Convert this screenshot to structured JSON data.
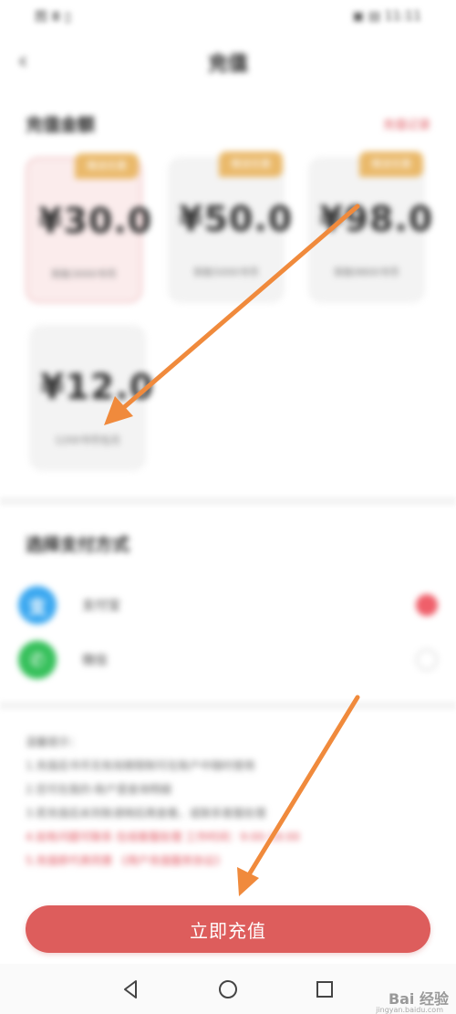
{
  "status_bar": {
    "left": "图 Ⅲ ▯",
    "right": "▣ ▤ 11:11"
  },
  "header": {
    "title": "充值",
    "back_glyph": "‹"
  },
  "amount_section": {
    "title": "充值金额",
    "link": "充值记录",
    "cards": [
      {
        "badge": "赠送优惠",
        "amount": "¥30.0",
        "desc": "到账3000书币",
        "selected": true
      },
      {
        "badge": "赠送优惠",
        "amount": "¥50.0",
        "desc": "到账5000书币",
        "selected": false
      },
      {
        "badge": "赠送优惠",
        "amount": "¥98.0",
        "desc": "到账9800书币",
        "selected": false
      },
      {
        "badge": "",
        "amount": "¥12.0",
        "desc": "1200书币包月",
        "selected": false
      }
    ]
  },
  "payment": {
    "title": "选择支付方式",
    "methods": [
      {
        "label": "支付宝",
        "icon": "alipay-icon",
        "glyph": "支",
        "color": "#3ba8f0",
        "checked": true
      },
      {
        "label": "微信",
        "icon": "wechat-icon",
        "glyph": "✆",
        "color": "#36c05b",
        "checked": false
      }
    ]
  },
  "notes": {
    "lines": [
      "温馨提示：",
      "1.充值后书币无有效期限制可在账户中随时使用",
      "2.您可在我的-账户里查询明细",
      "3.若充值后未到账请稍后再查看，或联系客服处理",
      "4.如有问题可联系 在线客服处理 工作时间：9:00-18:00",
      "5.充值即代表同意 《用户充值服务协议》"
    ]
  },
  "cta": {
    "label": "立即充值"
  },
  "watermark": {
    "main": "Bai 经验",
    "sub": "jingyan.baidu.com"
  },
  "colors": {
    "accent": "#dd5d5c",
    "badge": "#eab96a",
    "annotation_arrow": "#f08a3c"
  }
}
